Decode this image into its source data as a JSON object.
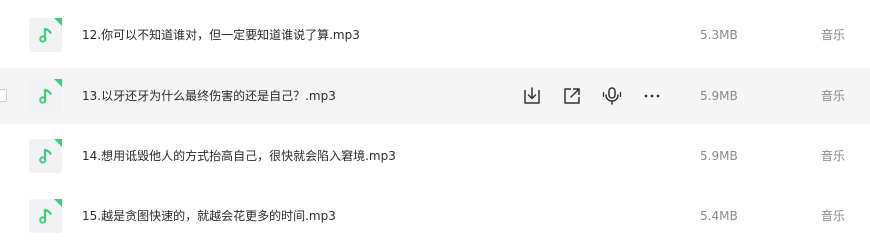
{
  "colors": {
    "accent": "#3ecf7e",
    "row_hover": "#f5f5f6",
    "text": "#2b2b2b",
    "muted": "#8a8a8a"
  },
  "files": [
    {
      "name": "12.你可以不知道谁对，但一定要知道谁说了算.mp3",
      "size": "5.3MB",
      "type": "音乐",
      "icon": "music-note-icon"
    },
    {
      "name": "13.以牙还牙为什么最终伤害的还是自己？.mp3",
      "size": "5.9MB",
      "type": "音乐",
      "icon": "music-note-icon",
      "hovered": true
    },
    {
      "name": "14.想用诋毁他人的方式抬高自己，很快就会陷入窘境.mp3",
      "size": "5.9MB",
      "type": "音乐",
      "icon": "music-note-icon"
    },
    {
      "name": "15.越是贪图快速的，就越会花更多的时间.mp3",
      "size": "5.4MB",
      "type": "音乐",
      "icon": "music-note-icon"
    }
  ],
  "row_actions": [
    "download-icon",
    "share-icon",
    "voice-icon",
    "more-icon"
  ]
}
